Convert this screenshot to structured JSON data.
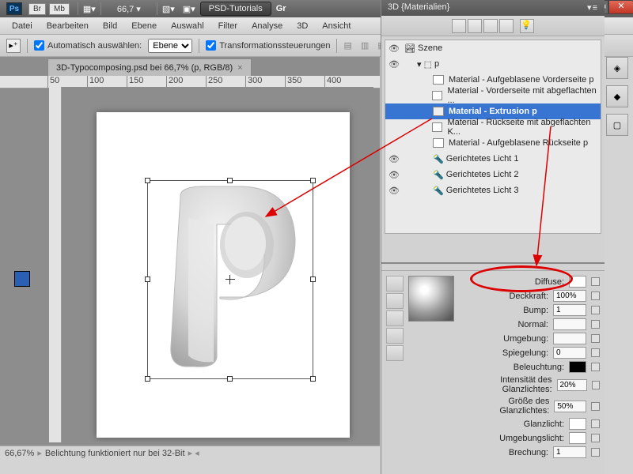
{
  "topbar": {
    "zoom": "66,7",
    "layout_label": "PSD-Tutorials",
    "badges": [
      "Br",
      "Mb"
    ],
    "right_label": "Gr"
  },
  "menu": [
    "Datei",
    "Bearbeiten",
    "Bild",
    "Ebene",
    "Auswahl",
    "Filter",
    "Analyse",
    "3D",
    "Ansicht"
  ],
  "options": {
    "auto_select": "Automatisch auswählen:",
    "target": "Ebene",
    "transform": "Transformationssteuerungen"
  },
  "doc": {
    "tab_title": "3D-Typocomposing.psd bei 66,7% (p, RGB/8)"
  },
  "ruler": [
    "50",
    "100",
    "150",
    "200",
    "250",
    "300",
    "350",
    "400"
  ],
  "status": {
    "zoom": "66,67%",
    "msg": "Belichtung funktioniert nur bei 32-Bit"
  },
  "panel": {
    "title": "3D {Materialien}",
    "scene_root": "Szene",
    "scene_obj": "p",
    "materials": [
      "Material - Aufgeblasene Vorderseite p",
      "Material - Vorderseite mit abgeflachten ...",
      "Material - Extrusion p",
      "Material - Rückseite mit abgeflachten K...",
      "Material - Aufgeblasene Rückseite p"
    ],
    "lights": [
      "Gerichtetes Licht 1",
      "Gerichtetes Licht 2",
      "Gerichtetes Licht 3"
    ]
  },
  "material": {
    "rows": [
      {
        "label": "Diffuse:",
        "val": "",
        "sw": "white",
        "menu": true
      },
      {
        "label": "Deckkraft:",
        "val": "100%",
        "sw": "",
        "menu": true
      },
      {
        "label": "Bump:",
        "val": "1",
        "sw": "",
        "menu": true
      },
      {
        "label": "Normal:",
        "val": "",
        "sw": "",
        "menu": true
      },
      {
        "label": "Umgebung:",
        "val": "",
        "sw": "",
        "menu": true
      },
      {
        "label": "Spiegelung:",
        "val": "0",
        "sw": "",
        "menu": true
      },
      {
        "label": "Beleuchtung:",
        "val": "",
        "sw": "black",
        "menu": true
      },
      {
        "label": "Intensität des Glanzlichtes:",
        "val": "20%",
        "sw": "",
        "menu": true
      },
      {
        "label": "Größe des Glanzlichtes:",
        "val": "50%",
        "sw": "",
        "menu": true
      },
      {
        "label": "Glanzlicht:",
        "val": "",
        "sw": "white",
        "menu": true
      },
      {
        "label": "Umgebungslicht:",
        "val": "",
        "sw": "white",
        "menu": true
      },
      {
        "label": "Brechung:",
        "val": "1",
        "sw": "",
        "menu": true
      }
    ]
  }
}
